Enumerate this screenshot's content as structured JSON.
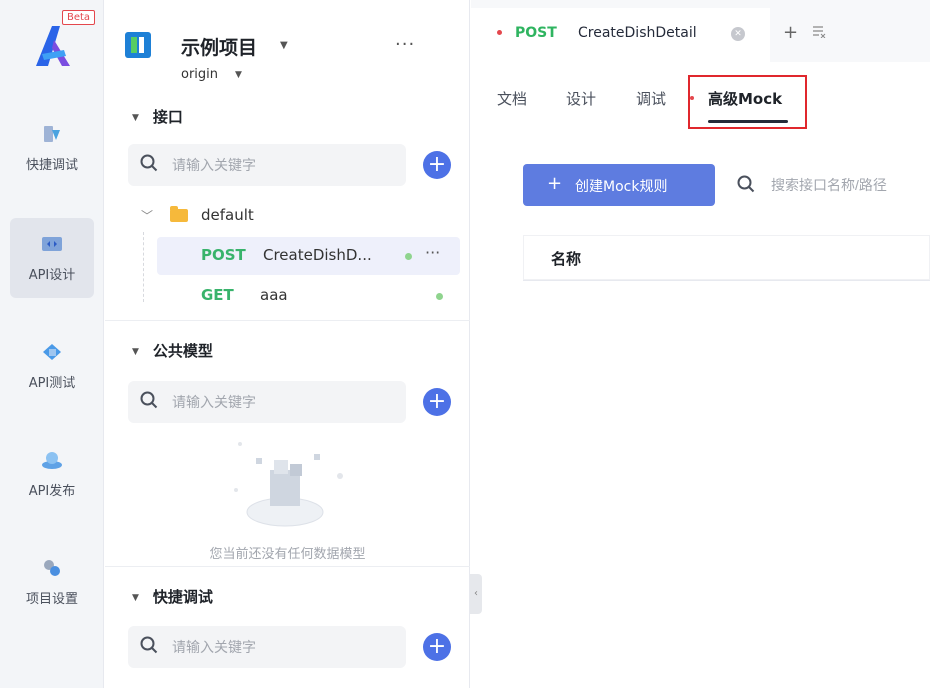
{
  "rail": {
    "beta": "Beta",
    "items": [
      {
        "label": "快捷调试",
        "icon": "quick-debug-icon"
      },
      {
        "label": "API设计",
        "icon": "api-design-icon"
      },
      {
        "label": "API测试",
        "icon": "api-test-icon"
      },
      {
        "label": "API发布",
        "icon": "api-publish-icon"
      },
      {
        "label": "项目设置",
        "icon": "project-settings-icon"
      }
    ]
  },
  "project": {
    "name": "示例项目",
    "branch": "origin",
    "more": "···"
  },
  "sections": {
    "interface": {
      "title": "接口",
      "placeholder": "请输入关键字"
    },
    "models": {
      "title": "公共模型",
      "placeholder": "请输入关键字",
      "empty": "您当前还没有任何数据模型"
    },
    "quick": {
      "title": "快捷调试",
      "placeholder": "请输入关键字"
    }
  },
  "tree": {
    "folder": "default",
    "apis": [
      {
        "method": "POST",
        "name": "CreateDishD..."
      },
      {
        "method": "GET",
        "name": "aaa"
      }
    ]
  },
  "tab": {
    "method": "POST",
    "name": "CreateDishDetail"
  },
  "subtabs": [
    "文档",
    "设计",
    "调试",
    "高级Mock"
  ],
  "mock": {
    "create_label": "创建Mock规则",
    "search_placeholder": "搜索接口名称/路径",
    "columns": [
      "名称"
    ]
  },
  "colors": {
    "accent": "#5e7ce0",
    "post": "#38b36b",
    "highlight": "#e0272d"
  }
}
